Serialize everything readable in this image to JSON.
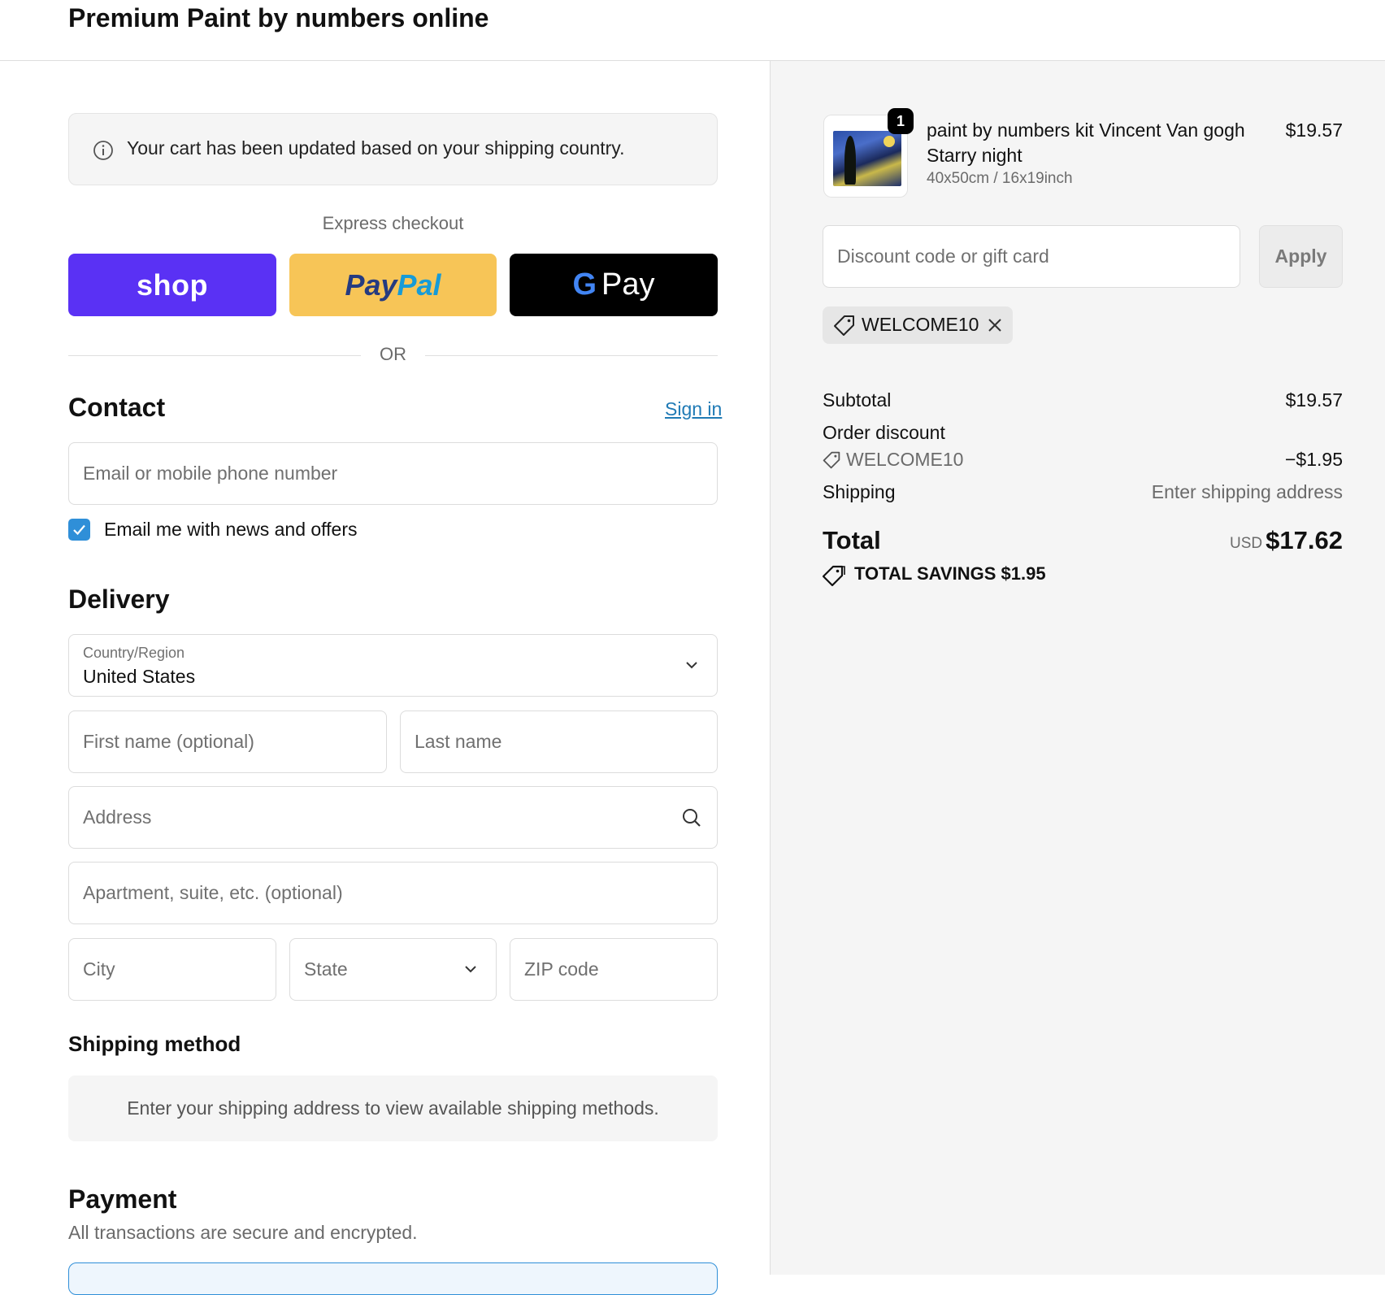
{
  "header": {
    "store_name": "Premium Paint by numbers online"
  },
  "notice": {
    "text": "Your cart has been updated based on your shipping country."
  },
  "express": {
    "label": "Express checkout",
    "shop_label": "shop",
    "paypal_label_1": "Pay",
    "paypal_label_2": "Pal",
    "gpay_g": "G",
    "gpay_label": "Pay",
    "or_label": "OR"
  },
  "contact": {
    "heading": "Contact",
    "signin_label": "Sign in",
    "email_placeholder": "Email or mobile phone number",
    "newsletter_label": "Email me with news and offers",
    "newsletter_checked": true
  },
  "delivery": {
    "heading": "Delivery",
    "country_label": "Country/Region",
    "country_value": "United States",
    "first_name_placeholder": "First name (optional)",
    "last_name_placeholder": "Last name",
    "address_placeholder": "Address",
    "apartment_placeholder": "Apartment, suite, etc. (optional)",
    "city_placeholder": "City",
    "state_placeholder": "State",
    "zip_placeholder": "ZIP code"
  },
  "shipping_method": {
    "heading": "Shipping method",
    "notice": "Enter your shipping address to view available shipping methods."
  },
  "payment": {
    "heading": "Payment",
    "subtitle": "All transactions are secure and encrypted."
  },
  "order": {
    "quantity": "1",
    "product_title": "paint by numbers kit Vincent Van gogh Starry night",
    "product_variant": "40x50cm / 16x19inch",
    "product_price": "$19.57",
    "discount_placeholder": "Discount code or gift card",
    "apply_label": "Apply",
    "applied_code": "WELCOME10",
    "subtotal_label": "Subtotal",
    "subtotal_value": "$19.57",
    "order_discount_label": "Order discount",
    "discount_code": "WELCOME10",
    "discount_value": "−$1.95",
    "shipping_label": "Shipping",
    "shipping_value": "Enter shipping address",
    "total_label": "Total",
    "total_currency": "USD",
    "total_value": "$17.62",
    "savings_text": "TOTAL SAVINGS  $1.95"
  },
  "colors": {
    "shop_purple": "#5a31f4",
    "paypal_yellow": "#f7c557",
    "link_blue": "#1f7ab5",
    "checkbox_blue": "#2f8fd8"
  }
}
